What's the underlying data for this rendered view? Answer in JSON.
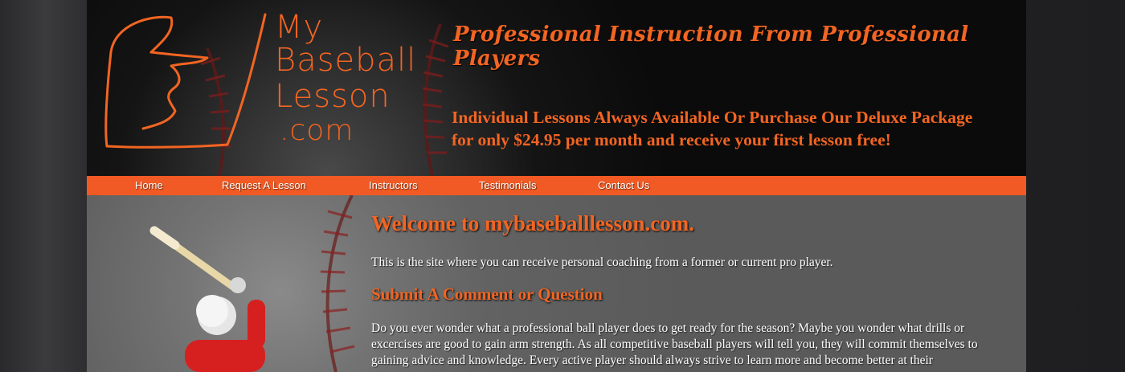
{
  "header": {
    "logo_lines": [
      "My",
      "Baseball",
      "Lesson",
      ".com"
    ],
    "tagline": "Professional Instruction From Professional Players",
    "promo_line1": "Individual Lessons Always Available Or Purchase Our Deluxe Package",
    "promo_line2": "for only $24.95 per month and receive your first lesson free!"
  },
  "nav": {
    "items": [
      {
        "label": "Home"
      },
      {
        "label": "Request A Lesson"
      },
      {
        "label": "Instructors"
      },
      {
        "label": "Testimonials"
      },
      {
        "label": "Contact Us"
      }
    ]
  },
  "main": {
    "welcome": "Welcome to mybaseballlesson.com.",
    "intro": "This is the site where you can receive personal coaching from a former or current pro player.",
    "subhead": "Submit A Comment or Question",
    "body": "Do you ever wonder what a professional ball player does to get ready for the season? Maybe you wonder what drills or excercises are good to gain arm strength. As all competitive baseball players will tell you, they will commit themselves to gaining advice and knowledge. Every active player should always strive to learn more and become better at their"
  },
  "colors": {
    "accent": "#f26522",
    "nav_bg": "#f15a24",
    "header_bg": "#0e0e0e",
    "main_bg": "#6a6a6a"
  }
}
